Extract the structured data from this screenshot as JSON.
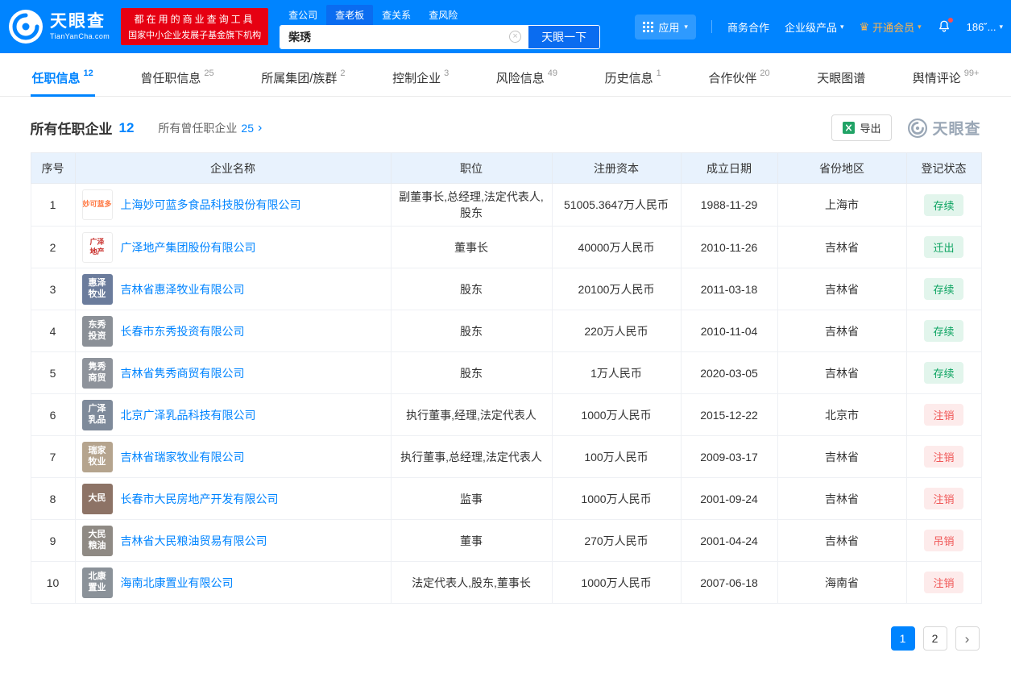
{
  "icons": {
    "caret_down": "▾",
    "chevron_right": "›",
    "next_page": "›",
    "crown": "♛",
    "clear": "×"
  },
  "header": {
    "logo_text": "天眼查",
    "logo_sub": "TianYanCha.com",
    "slogan_line1": "都在用的商业查询工具",
    "slogan_line2": "国家中小企业发展子基金旗下机构",
    "search_tabs": [
      {
        "label": "查公司",
        "active": false
      },
      {
        "label": "查老板",
        "active": true
      },
      {
        "label": "查关系",
        "active": false
      },
      {
        "label": "查风险",
        "active": false
      }
    ],
    "search_value": "柴琇",
    "search_button_label": "天眼一下",
    "nav": {
      "apps_label": "应用",
      "business_label": "商务合作",
      "enterprise_label": "企业级产品",
      "vip_label": "开通会员",
      "phone_label": "186˘..."
    }
  },
  "tabs": [
    {
      "label": "任职信息",
      "count": "12",
      "active": true
    },
    {
      "label": "曾任职信息",
      "count": "25",
      "active": false
    },
    {
      "label": "所属集团/族群",
      "count": "2",
      "active": false
    },
    {
      "label": "控制企业",
      "count": "3",
      "active": false
    },
    {
      "label": "风险信息",
      "count": "49",
      "active": false
    },
    {
      "label": "历史信息",
      "count": "1",
      "active": false
    },
    {
      "label": "合作伙伴",
      "count": "20",
      "active": false
    },
    {
      "label": "天眼图谱",
      "count": "",
      "active": false
    },
    {
      "label": "舆情评论",
      "count": "99+",
      "active": false
    }
  ],
  "section": {
    "title": "所有任职企业",
    "title_count": "12",
    "subtitle": "所有曾任职企业",
    "subtitle_count": "25",
    "export_label": "导出",
    "watermark_text": "天眼查"
  },
  "table": {
    "headers": [
      "序号",
      "企业名称",
      "职位",
      "注册资本",
      "成立日期",
      "省份地区",
      "登记状态"
    ],
    "rows": [
      {
        "no": "1",
        "logo": {
          "lines": [
            "妙可蓝多"
          ],
          "bg": "#ffffff",
          "color": "#ff7a45",
          "bordered": true
        },
        "company": "上海妙可蓝多食品科技股份有限公司",
        "position": "副董事长,总经理,法定代表人,股东",
        "capital": "51005.3647万人民币",
        "date": "1988-11-29",
        "province": "上海市",
        "status": "存续",
        "status_type": "green"
      },
      {
        "no": "2",
        "logo": {
          "lines": [
            "广泽",
            "地产"
          ],
          "bg": "#ffffff",
          "color": "#c9302c",
          "bordered": true
        },
        "company": "广泽地产集团股份有限公司",
        "position": "董事长",
        "capital": "40000万人民币",
        "date": "2010-11-26",
        "province": "吉林省",
        "status": "迁出",
        "status_type": "green"
      },
      {
        "no": "3",
        "logo": {
          "lines": [
            "惠泽",
            "牧业"
          ],
          "bg": "#6b7c9c",
          "color": "#ffffff",
          "bordered": false
        },
        "company": "吉林省惠泽牧业有限公司",
        "position": "股东",
        "capital": "20100万人民币",
        "date": "2011-03-18",
        "province": "吉林省",
        "status": "存续",
        "status_type": "green"
      },
      {
        "no": "4",
        "logo": {
          "lines": [
            "东秀",
            "投资"
          ],
          "bg": "#8b9097",
          "color": "#ffffff",
          "bordered": false
        },
        "company": "长春市东秀投资有限公司",
        "position": "股东",
        "capital": "220万人民币",
        "date": "2010-11-04",
        "province": "吉林省",
        "status": "存续",
        "status_type": "green"
      },
      {
        "no": "5",
        "logo": {
          "lines": [
            "隽秀",
            "商贸"
          ],
          "bg": "#8e939b",
          "color": "#ffffff",
          "bordered": false
        },
        "company": "吉林省隽秀商贸有限公司",
        "position": "股东",
        "capital": "1万人民币",
        "date": "2020-03-05",
        "province": "吉林省",
        "status": "存续",
        "status_type": "green"
      },
      {
        "no": "6",
        "logo": {
          "lines": [
            "广泽",
            "乳品"
          ],
          "bg": "#7e8a9a",
          "color": "#ffffff",
          "bordered": false
        },
        "company": "北京广泽乳品科技有限公司",
        "position": "执行董事,经理,法定代表人",
        "capital": "1000万人民币",
        "date": "2015-12-22",
        "province": "北京市",
        "status": "注销",
        "status_type": "red"
      },
      {
        "no": "7",
        "logo": {
          "lines": [
            "瑞家",
            "牧业"
          ],
          "bg": "#b5a48e",
          "color": "#ffffff",
          "bordered": false
        },
        "company": "吉林省瑞家牧业有限公司",
        "position": "执行董事,总经理,法定代表人",
        "capital": "100万人民币",
        "date": "2009-03-17",
        "province": "吉林省",
        "status": "注销",
        "status_type": "red"
      },
      {
        "no": "8",
        "logo": {
          "lines": [
            "大民"
          ],
          "bg": "#8d7366",
          "color": "#ffffff",
          "bordered": false
        },
        "company": "长春市大民房地产开发有限公司",
        "position": "监事",
        "capital": "1000万人民币",
        "date": "2001-09-24",
        "province": "吉林省",
        "status": "注销",
        "status_type": "red"
      },
      {
        "no": "9",
        "logo": {
          "lines": [
            "大民",
            "粮油"
          ],
          "bg": "#8f8a84",
          "color": "#ffffff",
          "bordered": false
        },
        "company": "吉林省大民粮油贸易有限公司",
        "position": "董事",
        "capital": "270万人民币",
        "date": "2001-04-24",
        "province": "吉林省",
        "status": "吊销",
        "status_type": "red"
      },
      {
        "no": "10",
        "logo": {
          "lines": [
            "北康",
            "置业"
          ],
          "bg": "#8b9299",
          "color": "#ffffff",
          "bordered": false
        },
        "company": "海南北康置业有限公司",
        "position": "法定代表人,股东,董事长",
        "capital": "1000万人民币",
        "date": "2007-06-18",
        "province": "海南省",
        "status": "注销",
        "status_type": "red"
      }
    ]
  },
  "pagination": {
    "pages": [
      "1",
      "2"
    ],
    "current": "1"
  }
}
